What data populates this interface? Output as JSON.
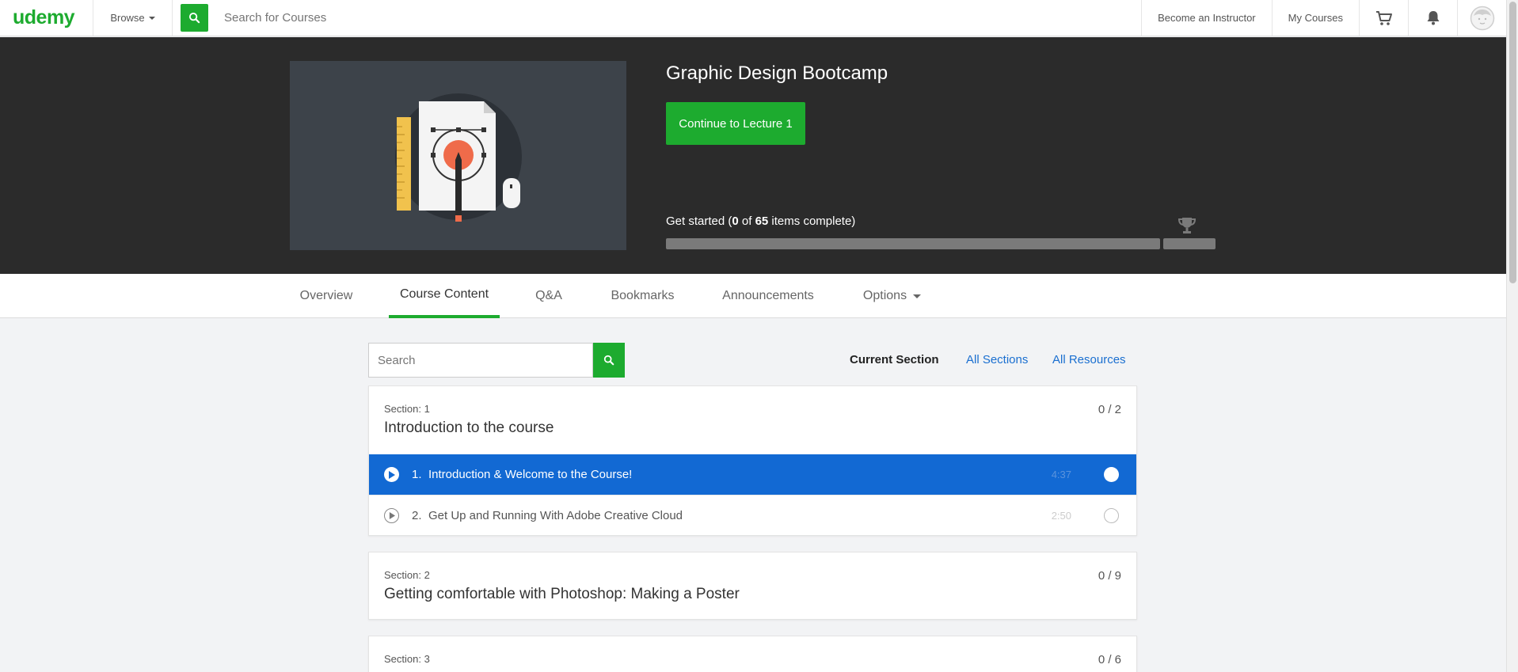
{
  "brand": {
    "logo_text": "udemy",
    "accent": "#1dab2f",
    "link_color": "#1a6fd0",
    "selected_color": "#1269d3"
  },
  "topnav": {
    "browse_label": "Browse",
    "search_placeholder": "Search for Courses",
    "become_instructor": "Become an Instructor",
    "my_courses": "My Courses",
    "icons": [
      "cart-icon",
      "bell-icon",
      "avatar"
    ]
  },
  "course": {
    "title": "Graphic Design Bootcamp",
    "continue_label": "Continue to Lecture 1",
    "progress_prefix": "Get started (",
    "completed": "0",
    "of_text": " of ",
    "total": "65",
    "progress_suffix": " items complete)",
    "progress_fraction": 0
  },
  "tabs": [
    {
      "label": "Overview",
      "active": false
    },
    {
      "label": "Course Content",
      "active": true
    },
    {
      "label": "Q&A",
      "active": false
    },
    {
      "label": "Bookmarks",
      "active": false
    },
    {
      "label": "Announcements",
      "active": false
    },
    {
      "label": "Options",
      "active": false
    }
  ],
  "content": {
    "search_placeholder": "Search",
    "filters": [
      "Current Section",
      "All Sections",
      "All Resources"
    ],
    "sections": [
      {
        "number_label": "Section: 1",
        "title": "Introduction to the course",
        "count": "0 / 2",
        "lectures": [
          {
            "num": "1.",
            "title": "Introduction & Welcome to the Course!",
            "duration": "4:37",
            "active": true
          },
          {
            "num": "2.",
            "title": "Get Up and Running With Adobe Creative Cloud",
            "duration": "2:50",
            "active": false
          }
        ]
      },
      {
        "number_label": "Section: 2",
        "title": "Getting comfortable with Photoshop: Making a Poster",
        "count": "0 / 9",
        "lectures": []
      },
      {
        "number_label": "Section: 3",
        "title": "",
        "count": "0 / 6",
        "lectures": []
      }
    ]
  }
}
